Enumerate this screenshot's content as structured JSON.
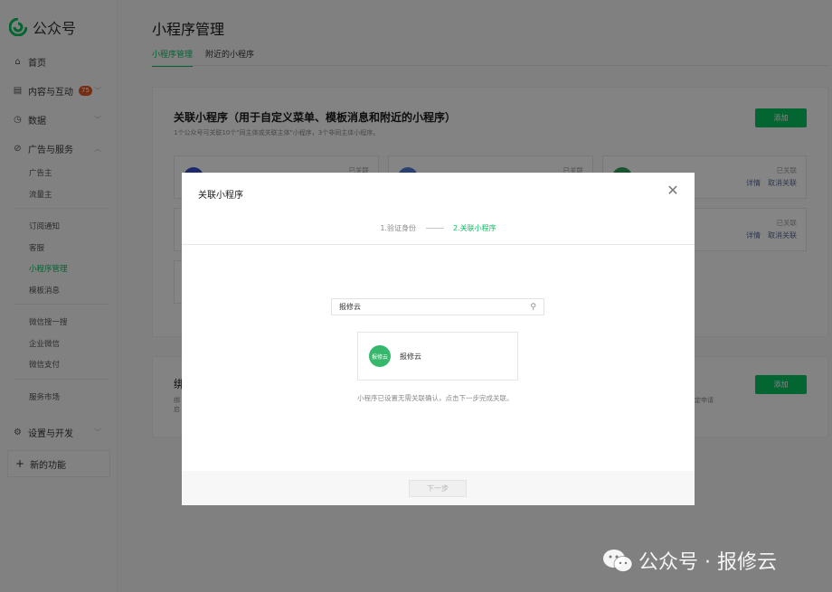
{
  "brand": {
    "name": "公众号"
  },
  "sidebar": {
    "home": "首页",
    "content": "内容与互动",
    "content_badge": "75",
    "data": "数据",
    "ads": "广告与服务",
    "ads_subs": [
      "广告主",
      "流量主"
    ],
    "group2": [
      "订阅通知",
      "客服",
      "小程序管理",
      "模板消息"
    ],
    "group3": [
      "微信搜一搜",
      "企业微信",
      "微信支付"
    ],
    "market": "服务市场",
    "settings": "设置与开发",
    "new_func": "新的功能"
  },
  "page": {
    "title": "小程序管理",
    "tabs": [
      "小程序管理",
      "附近的小程序"
    ]
  },
  "card1": {
    "title": "关联小程序（用于自定义菜单、模板消息和附近的小程序）",
    "desc": "1个公众号可关联10个\"同主体或关联主体\"小程序，3个非同主体小程序。",
    "add": "添加",
    "status": "已关联",
    "detail": "详情",
    "unlink": "取消关联"
  },
  "card2": {
    "title_char": "绑",
    "line1": "绑",
    "line2": "启",
    "right_text": "定申请",
    "add": "添加"
  },
  "modal": {
    "title": "关联小程序",
    "close": "✕",
    "step1": "1.验证身份",
    "step2": "2.关联小程序",
    "search_value": "报修云",
    "result_name": "报修云",
    "result_logo_text": "报修云",
    "hint": "小程序已设置无需关联确认，点击下一步完成关联。",
    "next": "下一步"
  },
  "watermark": {
    "text": "公众号 · 报修云"
  },
  "colors": {
    "accent": "#07c160",
    "link": "#576b95",
    "badge": "#e0562b"
  }
}
